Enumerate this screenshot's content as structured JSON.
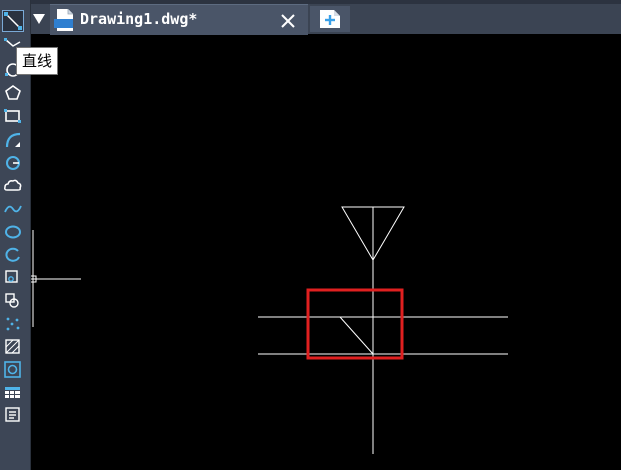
{
  "document": {
    "tab_title": "Drawing1.dwg*",
    "file_icon_text": "DWG"
  },
  "tooltip": {
    "text": "直线"
  },
  "toolbar": {
    "tools": [
      {
        "name": "line-tool",
        "icon": "line-icon",
        "active": true
      },
      {
        "name": "polyline-tool",
        "icon": "polyline-icon"
      },
      {
        "name": "circle-tool",
        "icon": "circle-icon"
      },
      {
        "name": "polygon-tool",
        "icon": "polygon-icon"
      },
      {
        "name": "rectangle-tool",
        "icon": "rectangle-icon"
      },
      {
        "name": "arc-tool",
        "icon": "arc-icon"
      },
      {
        "name": "circle-center-tool",
        "icon": "circle-center-icon"
      },
      {
        "name": "revision-cloud-tool",
        "icon": "cloud-icon"
      },
      {
        "name": "spline-tool",
        "icon": "spline-icon"
      },
      {
        "name": "ellipse-tool",
        "icon": "ellipse-icon"
      },
      {
        "name": "ellipse-arc-tool",
        "icon": "ellipse-arc-icon"
      },
      {
        "name": "insert-block-tool",
        "icon": "insert-block-icon"
      },
      {
        "name": "create-block-tool",
        "icon": "create-block-icon"
      },
      {
        "name": "point-tool",
        "icon": "point-icon"
      },
      {
        "name": "hatch-tool",
        "icon": "hatch-icon"
      },
      {
        "name": "region-tool",
        "icon": "region-icon"
      },
      {
        "name": "table-tool",
        "icon": "table-icon"
      },
      {
        "name": "mtext-tool",
        "icon": "mtext-icon"
      }
    ]
  },
  "colors": {
    "canvas_bg": "#000000",
    "toolbar_bg": "#3d4656",
    "tabbar_bg": "#3b4453",
    "tool_icon": "#ffffff",
    "tool_accent": "#4fb3e8",
    "highlight_box": "#e02020",
    "drawing_lines": "#ffffff"
  }
}
